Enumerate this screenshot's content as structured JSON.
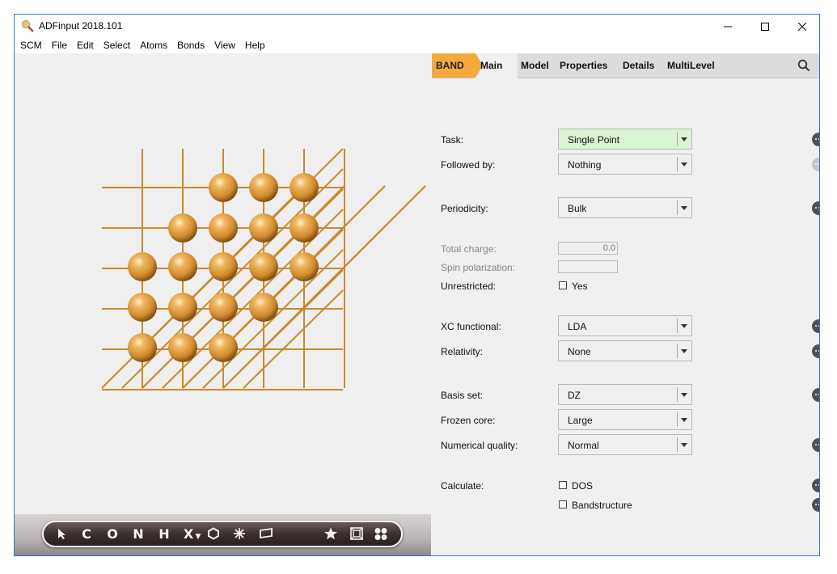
{
  "window": {
    "title": "ADFinput 2018.101"
  },
  "menu": {
    "items": [
      "SCM",
      "File",
      "Edit",
      "Select",
      "Atoms",
      "Bonds",
      "View",
      "Help"
    ]
  },
  "tabs": {
    "band": "BAND",
    "main": "Main",
    "model": "Model",
    "properties": "Properties",
    "details": "Details",
    "multilevel": "MultiLevel"
  },
  "form": {
    "task": {
      "label": "Task:",
      "value": "Single Point"
    },
    "followed_by": {
      "label": "Followed by:",
      "value": "Nothing"
    },
    "periodicity": {
      "label": "Periodicity:",
      "value": "Bulk"
    },
    "total_charge": {
      "label": "Total charge:",
      "value": "0.0"
    },
    "spin_polarization": {
      "label": "Spin polarization:",
      "value": ""
    },
    "unrestricted": {
      "label": "Unrestricted:",
      "option": "Yes",
      "checked": false
    },
    "xc_functional": {
      "label": "XC functional:",
      "value": "LDA"
    },
    "relativity": {
      "label": "Relativity:",
      "value": "None"
    },
    "basis_set": {
      "label": "Basis set:",
      "value": "DZ"
    },
    "frozen_core": {
      "label": "Frozen core:",
      "value": "Large"
    },
    "numerical_quality": {
      "label": "Numerical quality:",
      "value": "Normal"
    },
    "calculate": {
      "label": "Calculate:",
      "dos": "DOS",
      "bandstructure": "Bandstructure"
    }
  },
  "toolbar": {
    "tools": [
      "C",
      "O",
      "N",
      "H",
      "X"
    ]
  },
  "colors": {
    "accent": "#f4a93c",
    "active_field": "#d9f5d4",
    "atom": "#e6a04a",
    "bond": "#c98a2e"
  },
  "icons": [
    "app-icon",
    "minimize-icon",
    "maximize-icon",
    "close-icon",
    "search-icon",
    "more-icon",
    "pointer-icon",
    "ring-icon",
    "crystal-icon",
    "plane-icon",
    "star-icon",
    "cube-icon",
    "atoms-icon"
  ]
}
